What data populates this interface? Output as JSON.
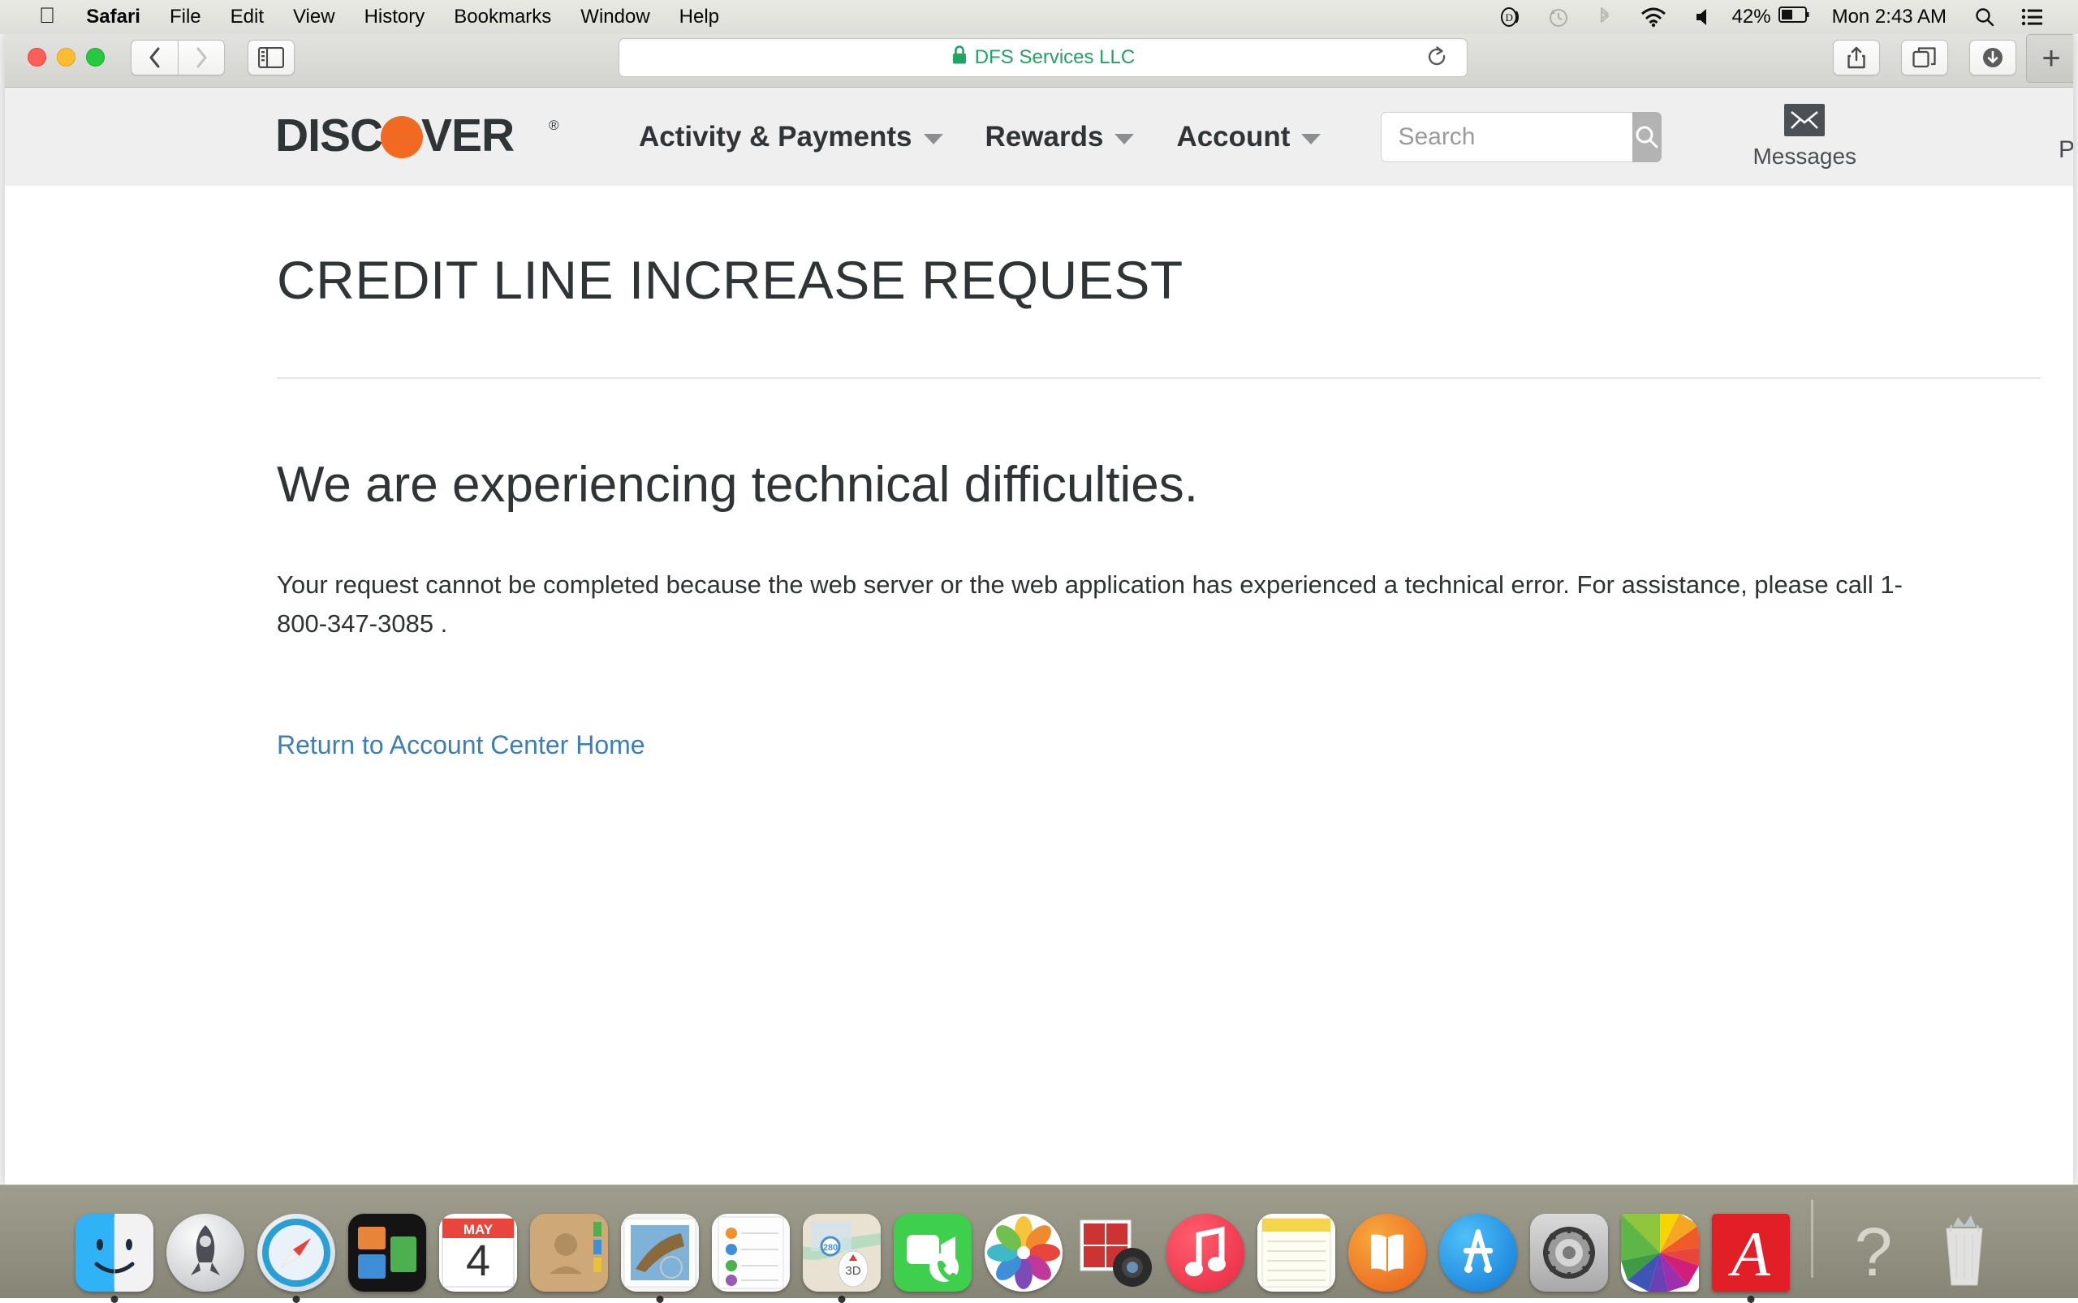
{
  "menubar": {
    "apple_logo": "apple-logo",
    "items": [
      {
        "label": "Safari",
        "bold": true
      },
      {
        "label": "File",
        "bold": false
      },
      {
        "label": "Edit",
        "bold": false
      },
      {
        "label": "View",
        "bold": false
      },
      {
        "label": "History",
        "bold": false
      },
      {
        "label": "Bookmarks",
        "bold": false
      },
      {
        "label": "Window",
        "bold": false
      },
      {
        "label": "Help",
        "bold": false
      }
    ],
    "status": {
      "dropbox_icon": "dropbox-icon",
      "timemachine_icon": "time-machine-icon",
      "bluetooth_icon": "bluetooth-icon",
      "wifi_icon": "wifi-icon",
      "volume_icon": "volume-icon",
      "battery_percent": "42%",
      "battery_icon": "battery-icon",
      "clock": "Mon 2:43 AM",
      "spotlight_icon": "search-icon",
      "notification_icon": "notification-center-icon"
    }
  },
  "browser": {
    "traffic_lights": {
      "close": "close",
      "minimize": "minimize",
      "zoom": "zoom"
    },
    "back_icon": "back-chevron-icon",
    "forward_icon": "forward-chevron-icon",
    "sidebar_icon": "sidebar-icon",
    "address": {
      "lock_icon": "lock-icon",
      "title": "DFS Services LLC",
      "lock_color": "#1fa463",
      "reload_icon": "reload-icon"
    },
    "share_icon": "share-icon",
    "tabs_icon": "tab-overview-icon",
    "downloads_icon": "downloads-icon",
    "new_tab_label": "+"
  },
  "site": {
    "logo": {
      "text": "DISCOVER",
      "registered_mark": "®",
      "circle_color": "#f26a21",
      "text_color": "#2f3437"
    },
    "nav": [
      {
        "label": "Activity & Payments",
        "has_caret": true
      },
      {
        "label": "Rewards",
        "has_caret": true
      },
      {
        "label": "Account",
        "has_caret": true
      }
    ],
    "search": {
      "placeholder": "Search",
      "value": "",
      "button_icon": "search-icon",
      "button_color": "#b3b3b3"
    },
    "header_right": [
      {
        "label": "Messages",
        "icon": "envelope-icon"
      },
      {
        "label": "P",
        "icon": "profile-icon",
        "clipped": true
      }
    ],
    "header_bg": "#efefef"
  },
  "main": {
    "page_title": "CREDIT LINE INCREASE REQUEST",
    "headline": "We are experiencing technical difficulties.",
    "body": "Your request cannot be completed because the web server or the web application has experienced a technical error. For assistance, please call 1-800-347-3085 .",
    "phone": "1-800-347-3085",
    "link_label": "Return to Account Center Home",
    "link_color": "#3d7fb5"
  },
  "dock": {
    "items": [
      {
        "name": "finder",
        "label": "Finder",
        "running": true
      },
      {
        "name": "launchpad",
        "label": "Launchpad",
        "running": false
      },
      {
        "name": "safari",
        "label": "Safari",
        "running": true
      },
      {
        "name": "mission-control",
        "label": "Mission Control",
        "running": false
      },
      {
        "name": "calendar",
        "label": "Calendar",
        "month": "MAY",
        "day": "4",
        "running": false
      },
      {
        "name": "contacts",
        "label": "Contacts",
        "running": false
      },
      {
        "name": "mail",
        "label": "Mail",
        "running": true
      },
      {
        "name": "reminders",
        "label": "Reminders",
        "running": false
      },
      {
        "name": "maps",
        "label": "Maps",
        "running": true
      },
      {
        "name": "facetime",
        "label": "FaceTime",
        "running": false
      },
      {
        "name": "photos",
        "label": "Photos",
        "running": false
      },
      {
        "name": "photo-booth",
        "label": "Photo Booth",
        "running": false
      },
      {
        "name": "itunes",
        "label": "iTunes",
        "running": false
      },
      {
        "name": "notes",
        "label": "Notes",
        "running": false
      },
      {
        "name": "ibooks",
        "label": "iBooks",
        "running": false
      },
      {
        "name": "app-store",
        "label": "App Store",
        "running": false
      },
      {
        "name": "system-preferences",
        "label": "System Preferences",
        "running": false
      },
      {
        "name": "iphoto",
        "label": "iPhoto",
        "running": false
      },
      {
        "name": "adobe-reader",
        "label": "Adobe Reader",
        "running": true
      }
    ],
    "trailing": [
      {
        "name": "help",
        "label": "?"
      },
      {
        "name": "trash",
        "label": "Trash"
      }
    ]
  }
}
